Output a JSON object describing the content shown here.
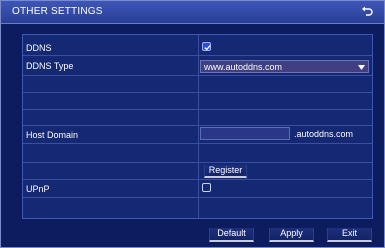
{
  "window": {
    "title": "OTHER SETTINGS",
    "back_icon": "back-arrow-icon"
  },
  "rows": {
    "ddns": {
      "label": "DDNS",
      "checked": true
    },
    "ddns_type": {
      "label": "DDNS Type",
      "value": "www.autoddns.com"
    },
    "host_domain": {
      "label": "Host Domain",
      "value": "",
      "suffix": ".autoddns.com"
    },
    "register": {
      "label": "Register"
    },
    "upnp": {
      "label": "UPnP",
      "checked": false
    }
  },
  "buttons": {
    "default": "Default",
    "apply": "Apply",
    "exit": "Exit"
  },
  "colors": {
    "background": "#0b1a55",
    "panel": "#142873",
    "select": "#3f3f82",
    "accent": "#2c4dd8"
  }
}
